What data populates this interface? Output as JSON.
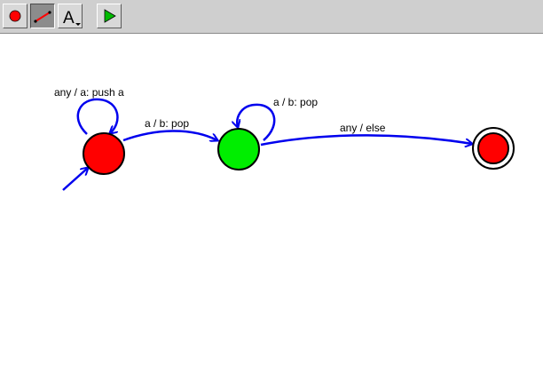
{
  "toolbar": {
    "tools": [
      {
        "name": "add-state-tool",
        "icon": "red-dot-icon",
        "active": false
      },
      {
        "name": "add-transition-tool",
        "icon": "arrow-line-icon",
        "active": true
      },
      {
        "name": "text-tool",
        "icon": "letter-a-icon",
        "glyph": "A",
        "active": false
      },
      {
        "name": "run-tool",
        "icon": "play-icon",
        "active": false
      }
    ]
  },
  "colors": {
    "state_start": "#ff0000",
    "state_middle": "#00ee00",
    "state_final": "#ff0000",
    "edge": "#0000ee",
    "play": "#00bb00"
  },
  "automaton": {
    "states": [
      {
        "id": "q0",
        "role": "start"
      },
      {
        "id": "q1",
        "role": "intermediate"
      },
      {
        "id": "q2",
        "role": "final"
      }
    ],
    "transitions": [
      {
        "id": "t-q0-self",
        "label": "any / a: push a"
      },
      {
        "id": "t-q0-q1",
        "label": "a / b: pop"
      },
      {
        "id": "t-q1-self",
        "label": "a / b: pop"
      },
      {
        "id": "t-q1-q2",
        "label": "any / else"
      }
    ]
  }
}
